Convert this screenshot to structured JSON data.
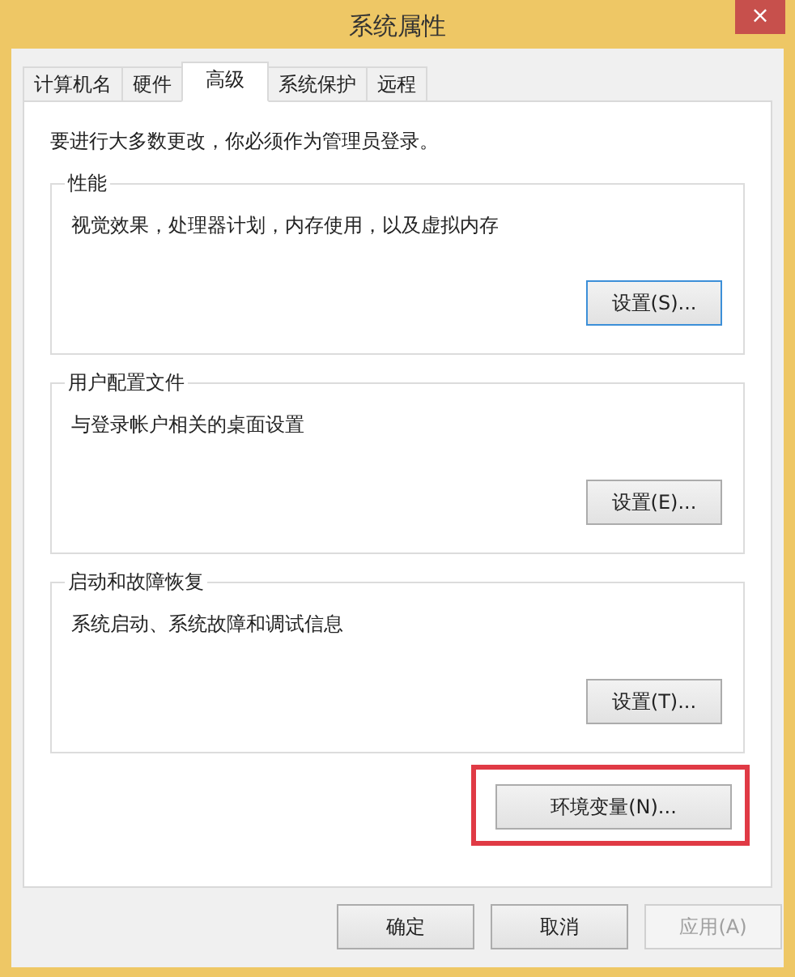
{
  "window": {
    "title": "系统属性",
    "close": "×"
  },
  "tabs": [
    {
      "label": "计算机名",
      "selected": false
    },
    {
      "label": "硬件",
      "selected": false
    },
    {
      "label": "高级",
      "selected": true
    },
    {
      "label": "系统保护",
      "selected": false
    },
    {
      "label": "远程",
      "selected": false
    }
  ],
  "notice": "要进行大多数更改，你必须作为管理员登录。",
  "groups": [
    {
      "title": "性能",
      "description": "视觉效果，处理器计划，内存使用，以及虚拟内存",
      "button": {
        "label": "设置(S)...",
        "focused": true
      }
    },
    {
      "title": "用户配置文件",
      "description": "与登录帐户相关的桌面设置",
      "button": {
        "label": "设置(E)...",
        "focused": false
      }
    },
    {
      "title": "启动和故障恢复",
      "description": "系统启动、系统故障和调试信息",
      "button": {
        "label": "设置(T)...",
        "focused": false
      }
    }
  ],
  "env_button": {
    "label": "环境变量(N)...",
    "highlighted": true
  },
  "buttons": [
    {
      "label": "确定",
      "disabled": false
    },
    {
      "label": "取消",
      "disabled": false
    },
    {
      "label": "应用(A)",
      "disabled": true
    }
  ]
}
